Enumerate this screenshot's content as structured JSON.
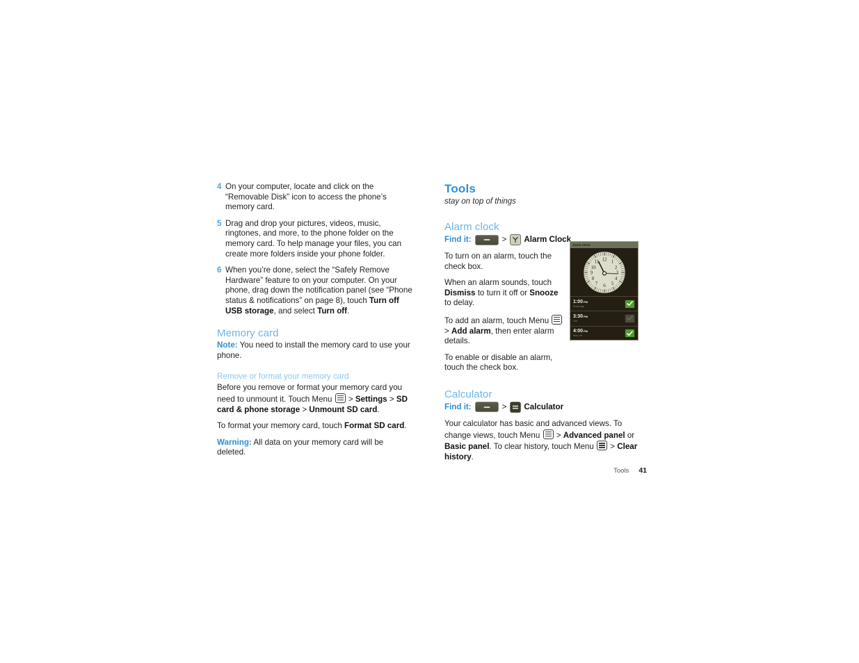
{
  "left_column": {
    "steps": [
      {
        "number": "4",
        "text": "On your computer, locate and click on the “Removable Disk” icon to access the phone’s memory card."
      },
      {
        "number": "5",
        "text": "Drag and drop your pictures, videos, music, ringtones, and more, to the phone folder on the memory card. To help manage your files, you can create more folders inside your phone folder."
      },
      {
        "number": "6",
        "text_part1": "When you’re done, select the “Safely Remove Hardware” feature to on your computer. On your phone, drag down the notification panel (see “Phone status & notifications” on page 8), touch ",
        "bold1": "Turn off USB storage",
        "text_part2": ", and select ",
        "bold2": "Turn off",
        "text_part3": "."
      }
    ],
    "memory_card": {
      "heading": "Memory card",
      "note_label": "Note:",
      "note_text": " You need to install the memory card to use your phone.",
      "subsection_heading": "Remove or format your memory card",
      "unmount_part1": "Before you remove or format your memory card you need to unmount it. Touch Menu ",
      "unmount_gt1": " > ",
      "unmount_bold1": "Settings",
      "unmount_gt2": " > ",
      "unmount_bold2": "SD card & phone storage",
      "unmount_gt3": " > ",
      "unmount_bold3": "Unmount SD card",
      "unmount_end": ".",
      "format_part1": "To format your memory card, touch ",
      "format_bold": "Format SD card",
      "format_end": ".",
      "warning_label": "Warning:",
      "warning_text": " All data on your memory card will be deleted."
    }
  },
  "right_column": {
    "chapter_title": "Tools",
    "chapter_subtitle": "stay on top of things",
    "alarm_clock": {
      "heading": "Alarm clock",
      "findit_label": "Find it:",
      "findit_separator": ">",
      "launcher_icon": "launcher-key-icon",
      "app_icon": "alarm-clock-app-icon",
      "app_name": "Alarm Clock",
      "p1": "To turn on an alarm, touch the check box.",
      "p2_part1": "When an alarm sounds, touch ",
      "p2_bold1": "Dismiss",
      "p2_part2": " to turn it off or ",
      "p2_bold2": "Snooze",
      "p2_part3": " to delay.",
      "p3_part1": "To add an alarm, touch Menu ",
      "p3_gt": "> ",
      "p3_bold": "Add alarm",
      "p3_part2": ", then enter alarm details.",
      "p4": "To enable or disable an alarm, touch the check box."
    },
    "calculator": {
      "heading": "Calculator",
      "findit_label": "Find it:",
      "findit_separator": ">",
      "launcher_icon": "launcher-key-icon",
      "app_icon": "calculator-app-icon",
      "app_name": "Calculator",
      "p1_part1": "Your calculator has basic and advanced views. To change views, touch Menu ",
      "p1_gt1": " > ",
      "p1_bold1": "Advanced panel",
      "p1_part2": " or ",
      "p1_bold2": "Basic panel",
      "p1_part3": ". To clear history, touch Menu ",
      "p1_gt2": " > ",
      "p1_bold3": "Clear history",
      "p1_end": "."
    }
  },
  "screenshot": {
    "title": "Alarm Clock",
    "clock_face": {
      "numerals": [
        "12",
        "1",
        "2",
        "3",
        "4",
        "5",
        "6",
        "7",
        "8",
        "9",
        "10",
        "11"
      ],
      "hour_hand_position": "11",
      "minute_hand_position": "3"
    },
    "alarms": [
      {
        "time": "1:00",
        "ampm": "PM",
        "days": "Every day",
        "enabled": true
      },
      {
        "time": "3:30",
        "ampm": "PM",
        "days": "Tue",
        "enabled": false
      },
      {
        "time": "4:00",
        "ampm": "PM",
        "days": "Mon, Fri",
        "enabled": true
      }
    ]
  },
  "footer": {
    "section_label": "Tools",
    "page_number": "41"
  },
  "colors": {
    "heading_blue": "#6cb4e8",
    "chapter_blue": "#2e8fd4",
    "subsection_blue": "#8dc7ef",
    "step_number_blue": "#4da3e8",
    "body_text": "#222222",
    "check_green": "#4d9d2a"
  }
}
